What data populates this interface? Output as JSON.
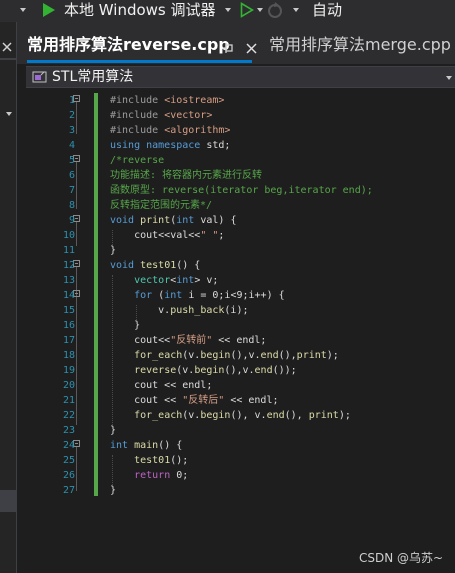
{
  "toolbar": {
    "debugger_label": "本地 Windows 调试器",
    "config_label": "自动"
  },
  "tabs": [
    {
      "label": "常用排序算法reverse.cpp",
      "active": true
    },
    {
      "label": "常用排序算法merge.cpp",
      "active": false
    }
  ],
  "navbar": {
    "scope": "STL常用算法"
  },
  "code_lines": [
    {
      "n": "1",
      "tokens": [
        [
          "p",
          "#include "
        ],
        [
          "s",
          "<iostream>"
        ]
      ]
    },
    {
      "n": "2",
      "tokens": [
        [
          "p",
          "#include "
        ],
        [
          "s",
          "<vector>"
        ]
      ]
    },
    {
      "n": "3",
      "tokens": [
        [
          "p",
          "#include "
        ],
        [
          "s",
          "<algorithm>"
        ]
      ]
    },
    {
      "n": "4",
      "tokens": [
        [
          "k",
          "using namespace "
        ],
        [
          "",
          "std;"
        ]
      ]
    },
    {
      "n": "5",
      "tokens": [
        [
          "c",
          "/*reverse"
        ]
      ]
    },
    {
      "n": "6",
      "tokens": [
        [
          "c",
          "功能描述: 将容器内元素进行反转"
        ]
      ]
    },
    {
      "n": "7",
      "tokens": [
        [
          "c",
          "函数原型: reverse(iterator beg,iterator end);"
        ]
      ]
    },
    {
      "n": "8",
      "tokens": [
        [
          "c",
          "反转指定范围的元素*/"
        ]
      ]
    },
    {
      "n": "9",
      "tokens": [
        [
          "k",
          "void "
        ],
        [
          "f",
          "print"
        ],
        [
          "",
          "("
        ],
        [
          "k",
          "int "
        ],
        [
          "",
          "val) {"
        ]
      ]
    },
    {
      "n": "10",
      "tokens": [
        [
          "",
          "    cout<<val<<"
        ],
        [
          "s",
          "\" \""
        ],
        [
          "",
          ";"
        ]
      ]
    },
    {
      "n": "11",
      "tokens": [
        [
          "",
          "}"
        ]
      ]
    },
    {
      "n": "12",
      "tokens": [
        [
          "k",
          "void "
        ],
        [
          "f",
          "test01"
        ],
        [
          "",
          "() {"
        ]
      ]
    },
    {
      "n": "13",
      "tokens": [
        [
          "",
          "    "
        ],
        [
          "t",
          "vector"
        ],
        [
          "",
          "<"
        ],
        [
          "k",
          "int"
        ],
        [
          "",
          "> v;"
        ]
      ]
    },
    {
      "n": "14",
      "tokens": [
        [
          "",
          "    "
        ],
        [
          "k",
          "for "
        ],
        [
          "",
          "("
        ],
        [
          "k",
          "int "
        ],
        [
          "",
          "i = 0;i<9;i++) {"
        ]
      ]
    },
    {
      "n": "15",
      "tokens": [
        [
          "",
          "        v."
        ],
        [
          "f",
          "push_back"
        ],
        [
          "",
          "(i);"
        ]
      ]
    },
    {
      "n": "16",
      "tokens": [
        [
          "",
          "    }"
        ]
      ]
    },
    {
      "n": "17",
      "tokens": [
        [
          "",
          "    cout<<"
        ],
        [
          "s",
          "\"反转前\""
        ],
        [
          "",
          " << endl;"
        ]
      ]
    },
    {
      "n": "18",
      "tokens": [
        [
          "",
          "    "
        ],
        [
          "f",
          "for_each"
        ],
        [
          "",
          "(v."
        ],
        [
          "f",
          "begin"
        ],
        [
          "",
          "(),v."
        ],
        [
          "f",
          "end"
        ],
        [
          "",
          "(),"
        ],
        [
          "f",
          "print"
        ],
        [
          "",
          ");"
        ]
      ]
    },
    {
      "n": "19",
      "tokens": [
        [
          "",
          "    "
        ],
        [
          "f",
          "reverse"
        ],
        [
          "",
          "(v."
        ],
        [
          "f",
          "begin"
        ],
        [
          "",
          "(),v."
        ],
        [
          "f",
          "end"
        ],
        [
          "",
          "());"
        ]
      ]
    },
    {
      "n": "20",
      "tokens": [
        [
          "",
          "    cout << endl;"
        ]
      ]
    },
    {
      "n": "21",
      "tokens": [
        [
          "",
          "    cout << "
        ],
        [
          "s",
          "\"反转后\""
        ],
        [
          "",
          " << endl;"
        ]
      ]
    },
    {
      "n": "22",
      "tokens": [
        [
          "",
          "    "
        ],
        [
          "f",
          "for_each"
        ],
        [
          "",
          "(v."
        ],
        [
          "f",
          "begin"
        ],
        [
          "",
          "(), v."
        ],
        [
          "f",
          "end"
        ],
        [
          "",
          "(), "
        ],
        [
          "f",
          "print"
        ],
        [
          "",
          ");"
        ]
      ]
    },
    {
      "n": "23",
      "tokens": [
        [
          "",
          "}"
        ]
      ]
    },
    {
      "n": "24",
      "tokens": [
        [
          "k",
          "int "
        ],
        [
          "f",
          "main"
        ],
        [
          "",
          "() {"
        ]
      ]
    },
    {
      "n": "25",
      "tokens": [
        [
          "",
          "    "
        ],
        [
          "f",
          "test01"
        ],
        [
          "",
          "();"
        ]
      ]
    },
    {
      "n": "26",
      "tokens": [
        [
          "",
          "    "
        ],
        [
          "m",
          "return "
        ],
        [
          "",
          "0;"
        ]
      ]
    },
    {
      "n": "27",
      "tokens": [
        [
          "",
          "}"
        ]
      ]
    }
  ],
  "watermark": "CSDN @乌苏~",
  "colors": {
    "accent": "#007acc",
    "keyword": "#569cd6",
    "string": "#d69d85",
    "comment": "#57a64a",
    "function": "#dcdcaa",
    "type": "#4ec9b0",
    "run": "#32b432"
  }
}
